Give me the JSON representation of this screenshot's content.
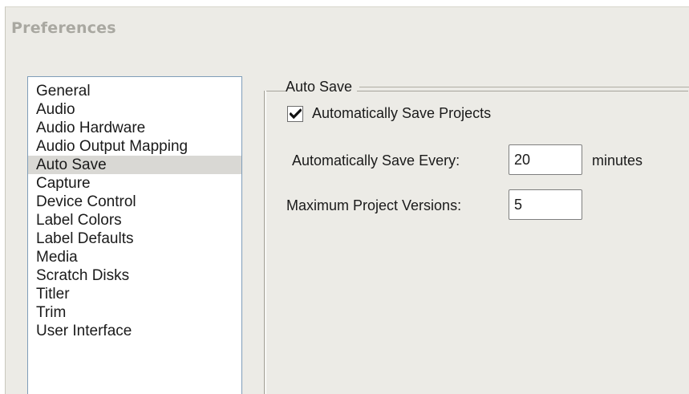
{
  "window": {
    "title": "Preferences"
  },
  "sidebar": {
    "selected_index": 4,
    "items": [
      {
        "label": "General"
      },
      {
        "label": "Audio"
      },
      {
        "label": "Audio Hardware"
      },
      {
        "label": "Audio Output Mapping"
      },
      {
        "label": "Auto Save"
      },
      {
        "label": "Capture"
      },
      {
        "label": "Device Control"
      },
      {
        "label": "Label Colors"
      },
      {
        "label": "Label Defaults"
      },
      {
        "label": "Media"
      },
      {
        "label": "Scratch Disks"
      },
      {
        "label": "Titler"
      },
      {
        "label": "Trim"
      },
      {
        "label": "User Interface"
      }
    ]
  },
  "auto_save": {
    "group_title": "Auto Save",
    "auto_save_projects": {
      "label": "Automatically Save Projects",
      "checked": true
    },
    "save_every": {
      "label": "Automatically Save Every:",
      "value": "20",
      "unit": "minutes"
    },
    "max_versions": {
      "label": "Maximum Project Versions:",
      "value": "5"
    }
  },
  "colors": {
    "window_bg": "#ecebe6",
    "list_border": "#7f9db9",
    "selected_bg": "#d9d8d4",
    "title_text": "#a9a8a1"
  }
}
